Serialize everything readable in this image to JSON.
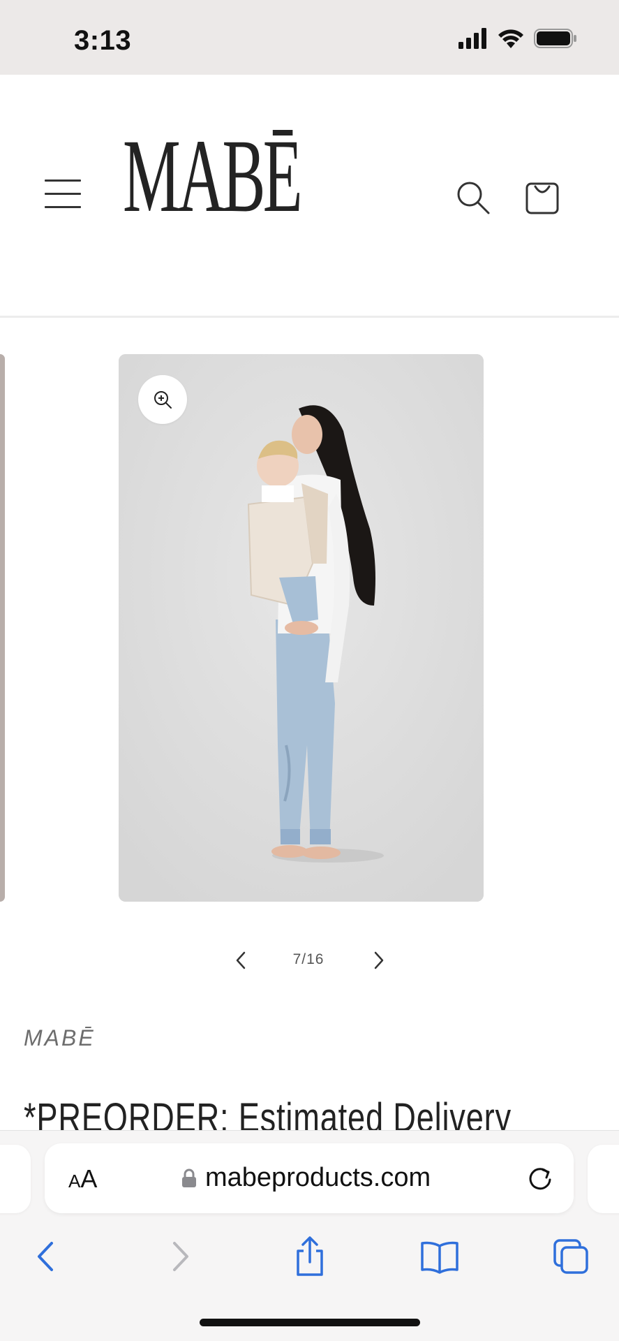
{
  "status_bar": {
    "time": "3:13"
  },
  "header": {
    "logo_text": "MABĒ"
  },
  "gallery": {
    "counter": "7/16"
  },
  "product": {
    "vendor": "MABĒ",
    "title": "*PREORDER: Estimated Delivery"
  },
  "browser": {
    "text_size_label": "AA",
    "url": "mabeproducts.com"
  },
  "colors": {
    "accent_blue": "#2f6fdb",
    "disabled_gray": "#b8b8bc"
  },
  "icons": [
    "menu-icon",
    "search-icon",
    "cart-icon",
    "zoom-in-icon",
    "chevron-left-icon",
    "chevron-right-icon",
    "lock-icon",
    "reload-icon",
    "back-icon",
    "forward-icon",
    "share-icon",
    "bookmarks-icon",
    "tabs-icon"
  ]
}
